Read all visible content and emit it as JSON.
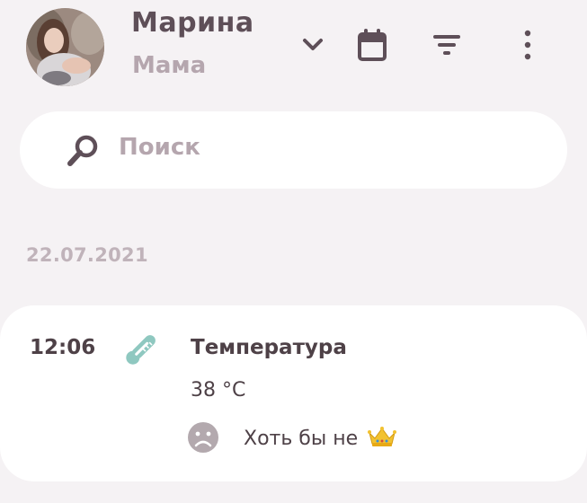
{
  "profile": {
    "name": "Марина",
    "role": "Мама"
  },
  "header": {
    "icons": [
      "chevron-down-icon",
      "calendar-icon",
      "filter-icon",
      "more-vert-icon"
    ]
  },
  "search": {
    "placeholder": "Поиск"
  },
  "feed": {
    "date": "22.07.2021",
    "entries": [
      {
        "time": "12:06",
        "type_icon": "thermometer-icon",
        "title": "Температура",
        "value": "38 °C",
        "mood_icon": "sad-face-icon",
        "note": "Хоть бы не",
        "note_icon": "crown-icon"
      }
    ]
  },
  "colors": {
    "background": "#f5f2f4",
    "card": "#ffffff",
    "text_primary": "#4e4147",
    "text_muted": "#b5a6ae",
    "accent_teal": "#8fc8c0"
  }
}
